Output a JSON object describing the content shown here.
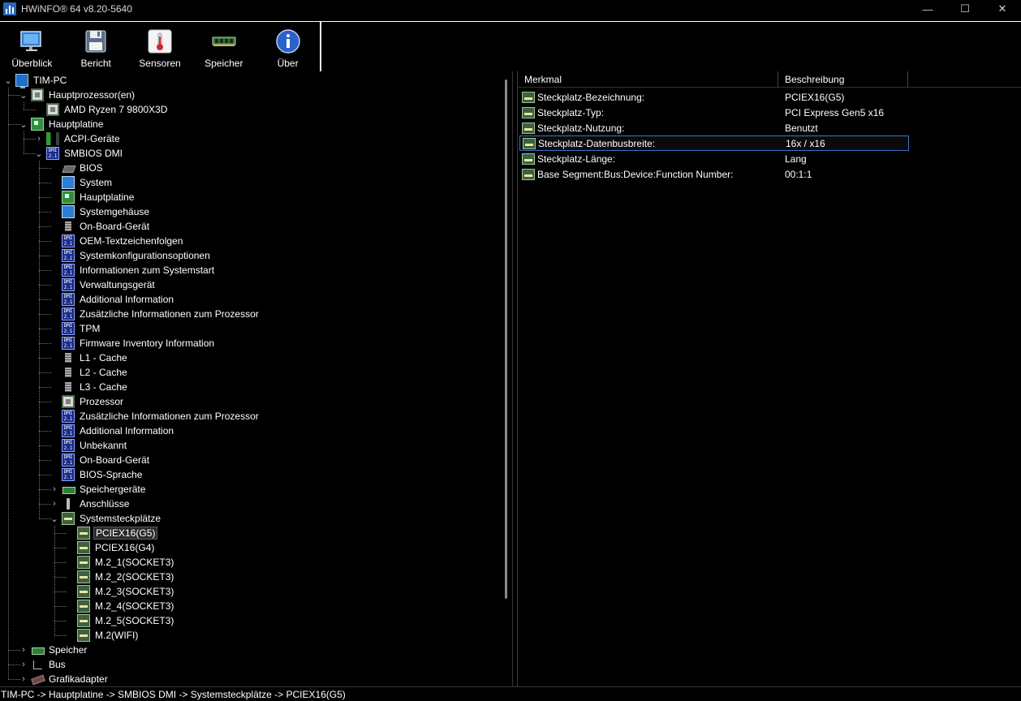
{
  "window": {
    "title": "HWiNFO® 64 v8.20-5640",
    "minimize": "—",
    "maximize": "☐",
    "close": "✕"
  },
  "toolbar": [
    {
      "label": "Überblick",
      "icon": "monitor-icon"
    },
    {
      "label": "Bericht",
      "icon": "floppy-icon"
    },
    {
      "label": "Sensoren",
      "icon": "thermometer-icon"
    },
    {
      "label": "Speicher",
      "icon": "ram-module-icon"
    },
    {
      "label": "Über",
      "icon": "info-icon"
    }
  ],
  "tree": [
    {
      "label": "TIM-PC",
      "level": 0,
      "expander": "⌄",
      "icon": "pc"
    },
    {
      "label": "Hauptprozessor(en)",
      "level": 1,
      "expander": "⌄",
      "icon": "chip"
    },
    {
      "label": "AMD Ryzen 7 9800X3D",
      "level": 2,
      "expander": "",
      "icon": "chip"
    },
    {
      "label": "Hauptplatine",
      "level": 1,
      "expander": "⌄",
      "icon": "board"
    },
    {
      "label": "ACPI-Geräte",
      "level": 2,
      "expander": "›",
      "icon": "acpi"
    },
    {
      "label": "SMBIOS DMI",
      "level": 2,
      "expander": "⌄",
      "icon": "dmi"
    },
    {
      "label": "BIOS",
      "level": 3,
      "expander": "",
      "icon": "bios"
    },
    {
      "label": "System",
      "level": 3,
      "expander": "",
      "icon": "monitor"
    },
    {
      "label": "Hauptplatine",
      "level": 3,
      "expander": "",
      "icon": "board"
    },
    {
      "label": "Systemgehäuse",
      "level": 3,
      "expander": "",
      "icon": "monitor"
    },
    {
      "label": "On-Board-Gerät",
      "level": 3,
      "expander": "",
      "icon": "mem"
    },
    {
      "label": "OEM-Textzeichenfolgen",
      "level": 3,
      "expander": "",
      "icon": "dmi"
    },
    {
      "label": "Systemkonfigurationsoptionen",
      "level": 3,
      "expander": "",
      "icon": "dmi"
    },
    {
      "label": "Informationen zum Systemstart",
      "level": 3,
      "expander": "",
      "icon": "dmi"
    },
    {
      "label": "Verwaltungsgerät",
      "level": 3,
      "expander": "",
      "icon": "dmi"
    },
    {
      "label": "Additional Information",
      "level": 3,
      "expander": "",
      "icon": "dmi"
    },
    {
      "label": "Zusätzliche Informationen zum Prozessor",
      "level": 3,
      "expander": "",
      "icon": "dmi"
    },
    {
      "label": "TPM",
      "level": 3,
      "expander": "",
      "icon": "dmi"
    },
    {
      "label": "Firmware Inventory Information",
      "level": 3,
      "expander": "",
      "icon": "dmi"
    },
    {
      "label": "L1 - Cache",
      "level": 3,
      "expander": "",
      "icon": "mem"
    },
    {
      "label": "L2 - Cache",
      "level": 3,
      "expander": "",
      "icon": "mem"
    },
    {
      "label": "L3 - Cache",
      "level": 3,
      "expander": "",
      "icon": "mem"
    },
    {
      "label": "Prozessor",
      "level": 3,
      "expander": "",
      "icon": "chip"
    },
    {
      "label": "Zusätzliche Informationen zum Prozessor",
      "level": 3,
      "expander": "",
      "icon": "dmi"
    },
    {
      "label": "Additional Information",
      "level": 3,
      "expander": "",
      "icon": "dmi"
    },
    {
      "label": "Unbekannt",
      "level": 3,
      "expander": "",
      "icon": "dmi"
    },
    {
      "label": "On-Board-Gerät",
      "level": 3,
      "expander": "",
      "icon": "dmi"
    },
    {
      "label": "BIOS-Sprache",
      "level": 3,
      "expander": "",
      "icon": "dmi"
    },
    {
      "label": "Speichergeräte",
      "level": 3,
      "expander": "›",
      "icon": "ram"
    },
    {
      "label": "Anschlüsse",
      "level": 3,
      "expander": "›",
      "icon": "port"
    },
    {
      "label": "Systemsteckplätze",
      "level": 3,
      "expander": "⌄",
      "icon": "slot"
    },
    {
      "label": "PCIEX16(G5)",
      "level": 4,
      "expander": "",
      "icon": "slot",
      "selected": true
    },
    {
      "label": "PCIEX16(G4)",
      "level": 4,
      "expander": "",
      "icon": "slot"
    },
    {
      "label": "M.2_1(SOCKET3)",
      "level": 4,
      "expander": "",
      "icon": "slot"
    },
    {
      "label": "M.2_2(SOCKET3)",
      "level": 4,
      "expander": "",
      "icon": "slot"
    },
    {
      "label": "M.2_3(SOCKET3)",
      "level": 4,
      "expander": "",
      "icon": "slot"
    },
    {
      "label": "M.2_4(SOCKET3)",
      "level": 4,
      "expander": "",
      "icon": "slot"
    },
    {
      "label": "M.2_5(SOCKET3)",
      "level": 4,
      "expander": "",
      "icon": "slot"
    },
    {
      "label": "M.2(WIFI)",
      "level": 4,
      "expander": "",
      "icon": "slot"
    },
    {
      "label": "Speicher",
      "level": 1,
      "expander": "›",
      "icon": "ram"
    },
    {
      "label": "Bus",
      "level": 1,
      "expander": "›",
      "icon": "bus"
    },
    {
      "label": "Grafikadapter",
      "level": 1,
      "expander": "›",
      "icon": "gpu"
    }
  ],
  "details": {
    "headers": {
      "feature": "Merkmal",
      "description": "Beschreibung"
    },
    "rows": [
      {
        "feature": "Steckplatz-Bezeichnung:",
        "value": "PCIEX16(G5)"
      },
      {
        "feature": "Steckplatz-Typ:",
        "value": "PCI Express Gen5 x16"
      },
      {
        "feature": "Steckplatz-Nutzung:",
        "value": "Benutzt"
      },
      {
        "feature": "Steckplatz-Datenbusbreite:",
        "value": "16x / x16",
        "selected": true
      },
      {
        "feature": "Steckplatz-Länge:",
        "value": "Lang"
      },
      {
        "feature": "Base Segment:Bus:Device:Function Number:",
        "value": "00:1:1"
      }
    ]
  },
  "statusbar": {
    "path": "TIM-PC -> Hauptplatine -> SMBIOS DMI -> Systemsteckplätze -> PCIEX16(G5)"
  }
}
